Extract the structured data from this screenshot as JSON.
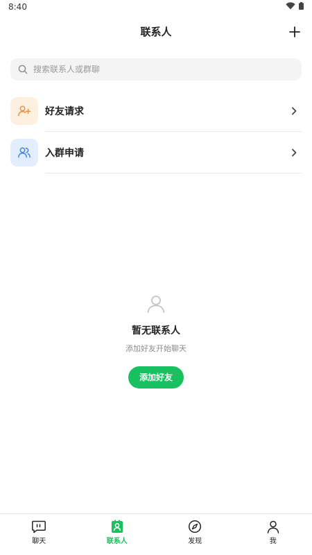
{
  "status_bar": {
    "time": "8:40"
  },
  "header": {
    "title": "联系人"
  },
  "search": {
    "placeholder": "搜索联系人或群聊"
  },
  "list": [
    {
      "label": "好友请求",
      "icon": "add-user-icon",
      "icon_bg": "#fdf0e0",
      "icon_color": "#ef8d3c"
    },
    {
      "label": "入群申请",
      "icon": "group-icon",
      "icon_bg": "#e3eefc",
      "icon_color": "#3d86e0"
    }
  ],
  "empty_state": {
    "title": "暂无联系人",
    "subtitle": "添加好友开始聊天",
    "button_label": "添加好友"
  },
  "tabbar": [
    {
      "label": "聊天",
      "icon": "chat-icon",
      "active": false
    },
    {
      "label": "联系人",
      "icon": "contacts-icon",
      "active": true
    },
    {
      "label": "发现",
      "icon": "compass-icon",
      "active": false
    },
    {
      "label": "我",
      "icon": "person-icon",
      "active": false
    }
  ],
  "colors": {
    "accent": "#17c15f",
    "text": "#222222",
    "muted": "#8c8c8c"
  }
}
